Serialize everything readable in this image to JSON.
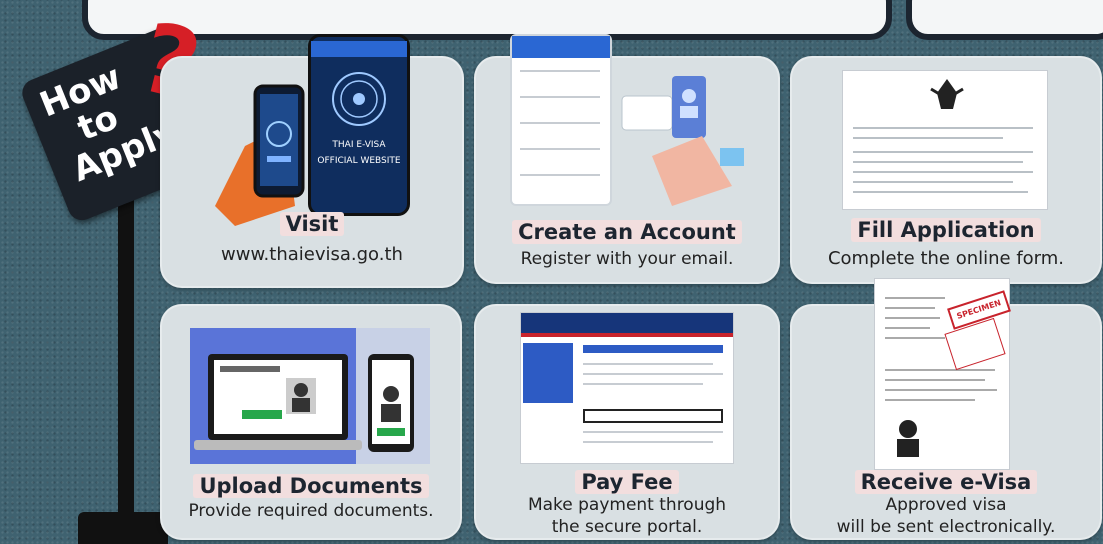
{
  "sign": {
    "line1": "How",
    "line2": "to",
    "line3": "Apply",
    "mark": "?"
  },
  "steps": [
    {
      "title": "Visit",
      "desc": "www.thaievisa.go.th",
      "phone_line1": "THAI E-VISA",
      "phone_line2": "OFFICIAL WEBSITE"
    },
    {
      "title": "Create an Account",
      "desc": "Register with your email."
    },
    {
      "title": "Fill Application",
      "desc": "Complete the online form."
    },
    {
      "title": "Upload Documents",
      "desc": "Provide required documents."
    },
    {
      "title": "Pay Fee",
      "desc_line1": "Make payment through",
      "desc_line2": "the secure portal."
    },
    {
      "title": "Receive e-Visa",
      "desc_line1": "Approved visa",
      "desc_line2": "will be sent electronically.",
      "stamp": "SPECIMEN"
    }
  ],
  "colors": {
    "background": "#3f6270",
    "card": "#d9e0e3",
    "accent_red": "#d61f26",
    "phone_blue": "#0f2d5e",
    "upload_blue": "#5a74d8"
  }
}
